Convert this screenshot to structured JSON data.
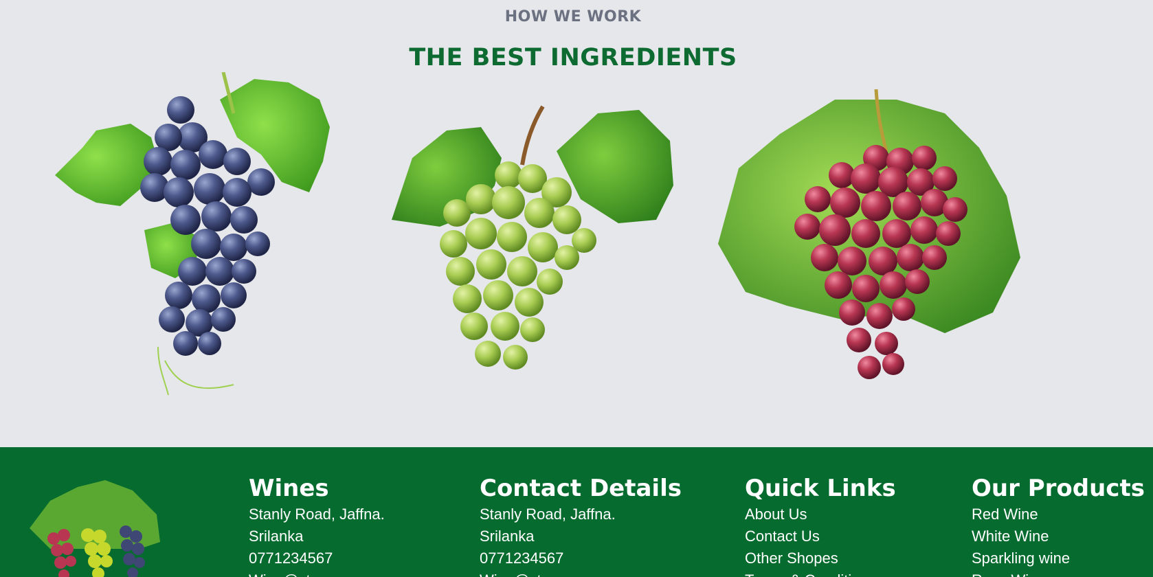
{
  "section": {
    "eyebrow": "HOW WE WORK",
    "title": "THE BEST INGREDIENTS"
  },
  "ingredients": [
    {
      "icon": "blue-grapes-image",
      "color": "#4a5688"
    },
    {
      "icon": "green-grapes-image",
      "color": "#a6c94a"
    },
    {
      "icon": "red-grapes-image",
      "color": "#b5384f"
    }
  ],
  "footer": {
    "background": "#066b2e",
    "logo_icon": "mixed-grapes-logo",
    "wines": {
      "title": "Wines",
      "lines": [
        "Stanly Road, Jaffna.",
        "Srilanka",
        "0771234567",
        "Wine@store.com"
      ]
    },
    "contact": {
      "title": "Contact Details",
      "lines": [
        "Stanly Road, Jaffna.",
        "Srilanka",
        "0771234567",
        "Wine@store.com"
      ]
    },
    "quick_links": {
      "title": "Quick Links",
      "links": [
        "About Us",
        "Contact Us",
        "Other Shopes",
        "Terms & Conditions"
      ]
    },
    "products": {
      "title": "Our Products",
      "links": [
        "Red Wine",
        "White Wine",
        "Sparkling wine",
        "Rose Wine"
      ]
    }
  }
}
